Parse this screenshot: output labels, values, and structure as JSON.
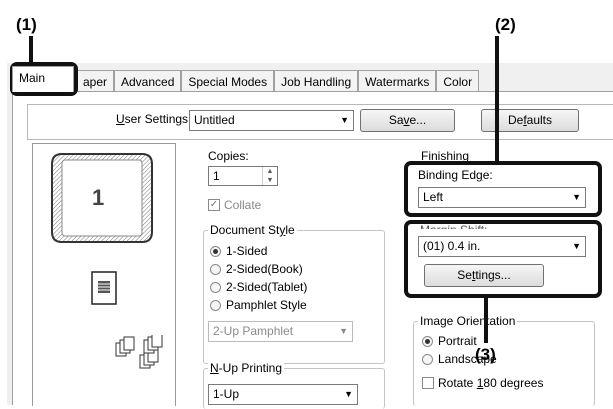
{
  "callouts": {
    "c1": "(1)",
    "c2": "(2)",
    "c3": "(3)"
  },
  "tabs": [
    "Main",
    "Paper",
    "Advanced",
    "Special Modes",
    "Job Handling",
    "Watermarks",
    "Color"
  ],
  "tab_visible_text": {
    "paper": "aper"
  },
  "user_settings": {
    "label": "User Settings:",
    "value": "Untitled",
    "save": "Save...",
    "defaults": "Defaults"
  },
  "preview": {
    "page_number": "1"
  },
  "copies": {
    "label": "Copies:",
    "value": "1",
    "collate": "Collate"
  },
  "document_style": {
    "legend": "Document Style",
    "options": [
      "1-Sided",
      "2-Sided(Book)",
      "2-Sided(Tablet)",
      "Pamphlet Style"
    ],
    "selected": "1-Sided",
    "pamphlet_select": "2-Up Pamphlet"
  },
  "nup": {
    "label": "N-Up Printing",
    "value": "1-Up"
  },
  "finishing": {
    "legend": "Finishing",
    "binding_label": "Binding Edge:",
    "binding_value": "Left",
    "margin_value": "(01) 0.4 in.",
    "settings_button": "Settings..."
  },
  "orientation": {
    "legend": "Image Orientation",
    "options": [
      "Portrait",
      "Landscape"
    ],
    "selected": "Portrait",
    "rotate": "Rotate 180 degrees"
  },
  "colors": {
    "callout_border": "#111111",
    "dialog_bg": "#f0f0f0"
  }
}
